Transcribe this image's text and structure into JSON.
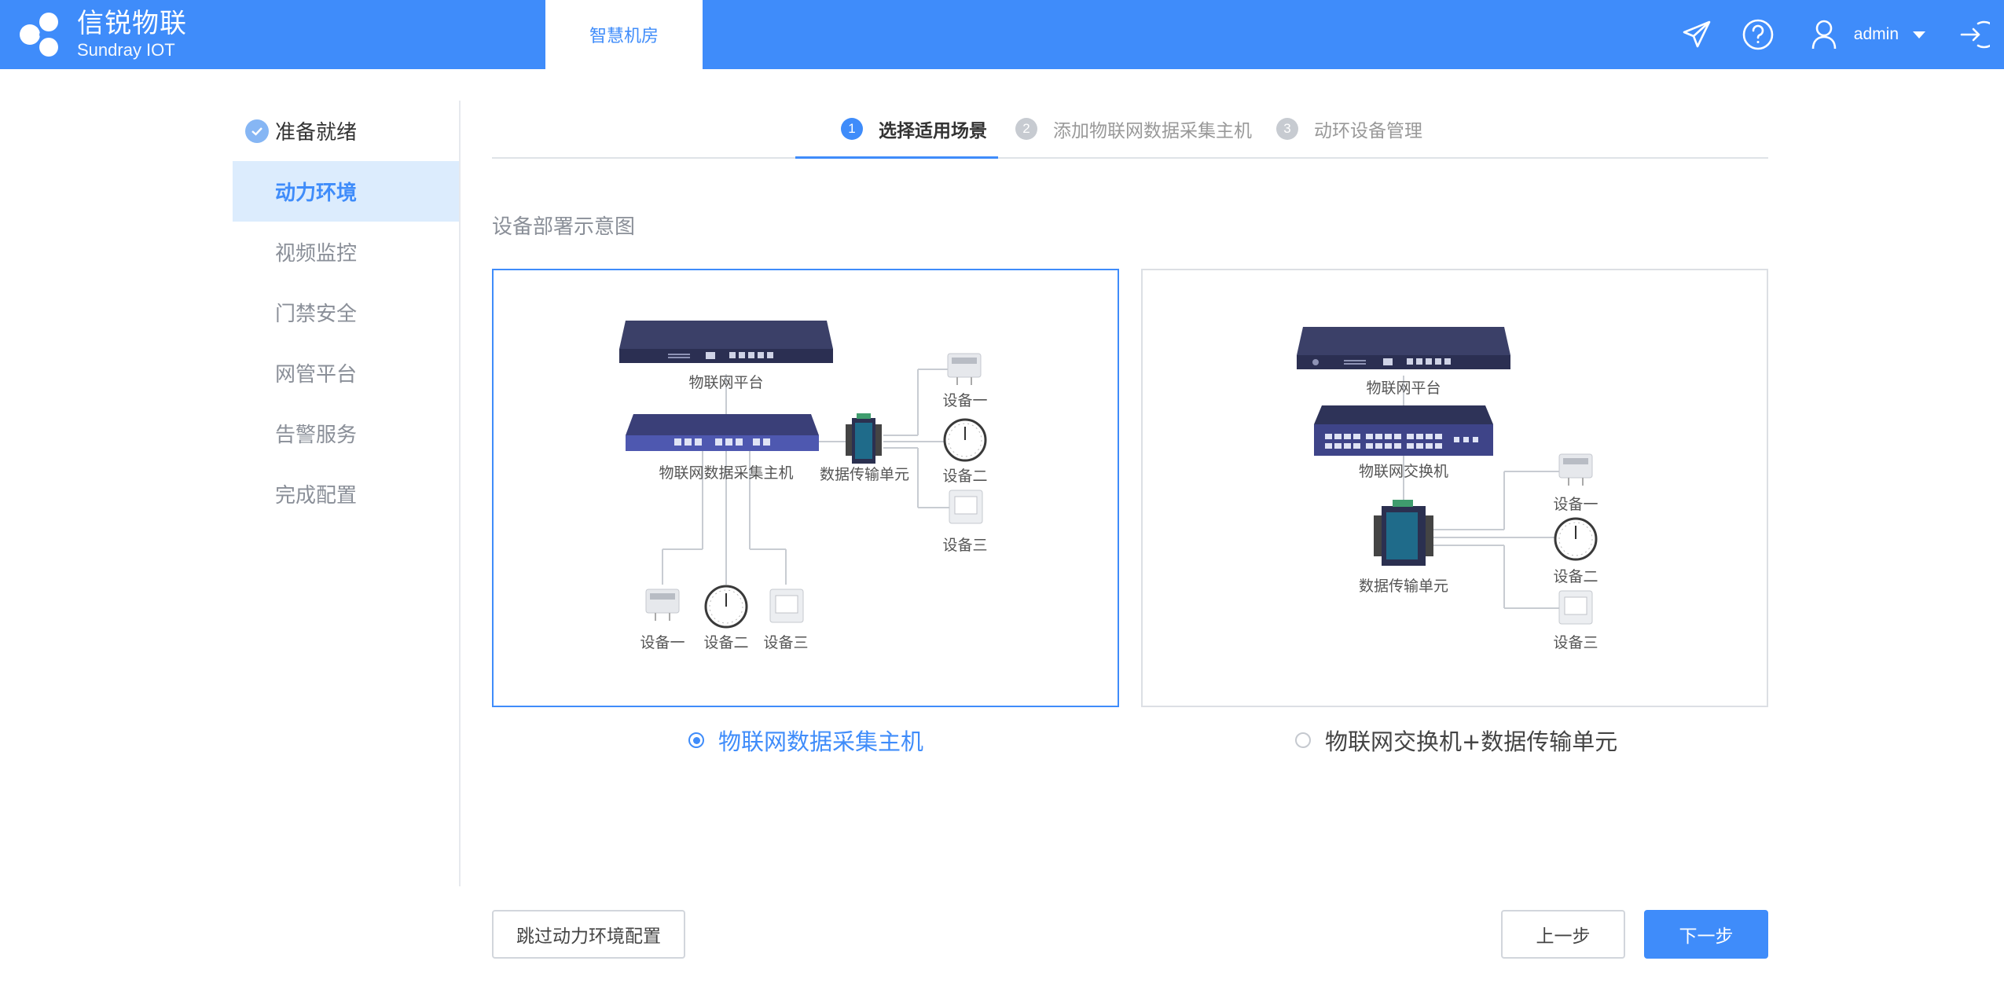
{
  "brand": {
    "name_cn": "信锐物联",
    "name_en": "Sundray IOT",
    "color": "#3f8cfa"
  },
  "header": {
    "active_tab": "智慧机房",
    "icons": [
      "send-icon",
      "help-icon",
      "user-icon",
      "logout-icon"
    ],
    "user": "admin"
  },
  "sidebar": {
    "items": [
      {
        "label": "准备就绪",
        "state": "done"
      },
      {
        "label": "动力环境",
        "state": "active"
      },
      {
        "label": "视频监控",
        "state": "pending"
      },
      {
        "label": "门禁安全",
        "state": "pending"
      },
      {
        "label": "网管平台",
        "state": "pending"
      },
      {
        "label": "告警服务",
        "state": "pending"
      },
      {
        "label": "完成配置",
        "state": "pending"
      }
    ]
  },
  "steps": [
    {
      "num": "1",
      "label": "选择适用场景",
      "state": "active"
    },
    {
      "num": "2",
      "label": "添加物联网数据采集主机",
      "state": "pending"
    },
    {
      "num": "3",
      "label": "动环设备管理",
      "state": "pending"
    }
  ],
  "main": {
    "section_title": "设备部署示意图",
    "options": [
      {
        "label": "物联网数据采集主机",
        "selected": true,
        "diagram": {
          "platform": "物联网平台",
          "host": "物联网数据采集主机",
          "dtu": "数据传输单元",
          "dev1": "设备一",
          "dev2": "设备二",
          "dev3": "设备三"
        }
      },
      {
        "label": "物联网交换机+数据传输单元",
        "selected": false,
        "diagram": {
          "platform": "物联网平台",
          "switch": "物联网交换机",
          "dtu": "数据传输单元",
          "dev1": "设备一",
          "dev2": "设备二",
          "dev3": "设备三"
        }
      }
    ]
  },
  "footer": {
    "skip": "跳过动力环境配置",
    "prev": "上一步",
    "next": "下一步"
  }
}
